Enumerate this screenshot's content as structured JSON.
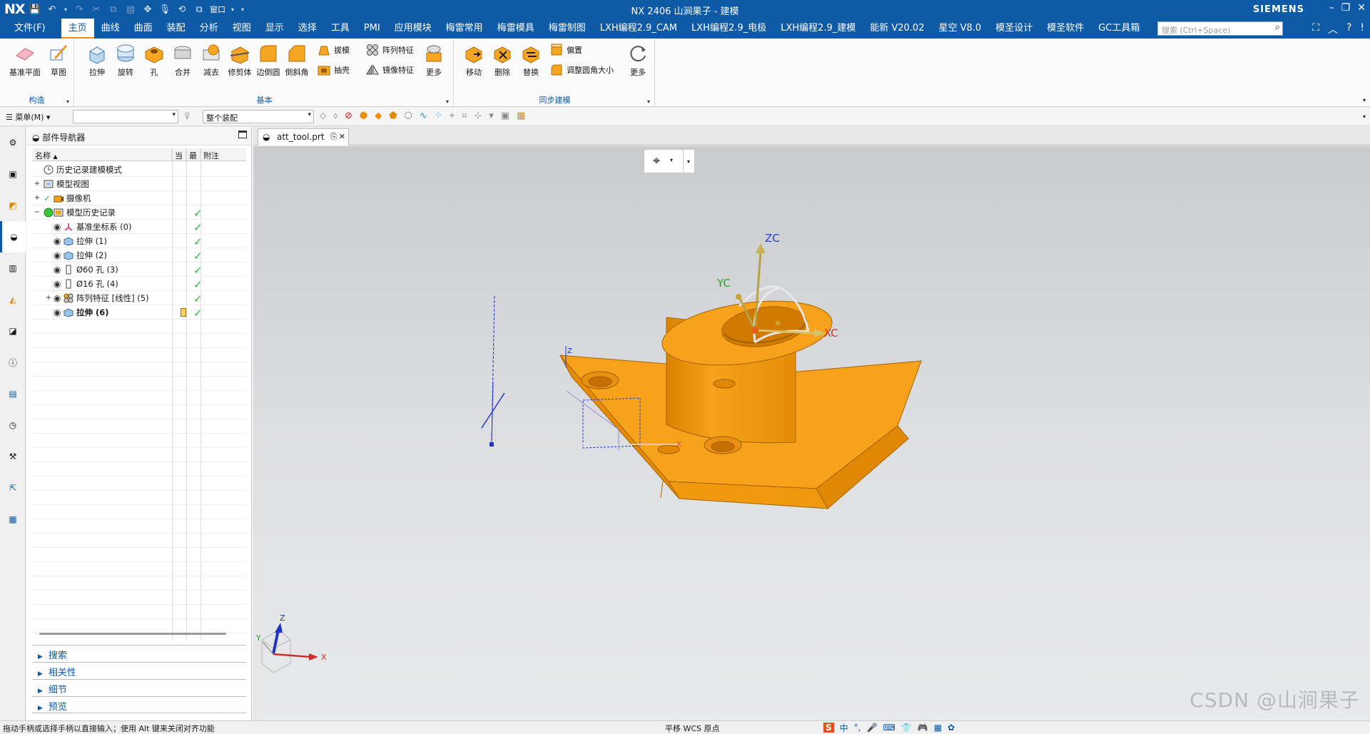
{
  "titlebar": {
    "logo": "NX",
    "title": "NX 2406 山涧果子 - 建模",
    "brand": "SIEMENS",
    "window_menu": "窗口"
  },
  "menubar": {
    "file": "文件(F)",
    "tabs": [
      "主页",
      "曲线",
      "曲面",
      "装配",
      "分析",
      "视图",
      "显示",
      "选择",
      "工具",
      "PMI",
      "应用模块",
      "梅雷常用",
      "梅雷模具",
      "梅雷制图",
      "LXH编程2.9_CAM",
      "LXH编程2.9_电极",
      "LXH编程2.9_建模",
      "能新 V20.02",
      "星空 V8.0",
      "模圣设计",
      "模圣软件",
      "GC工具箱"
    ],
    "active_tab": "主页",
    "search_placeholder": "搜索 (Ctrl+Space)"
  },
  "ribbon": {
    "construct": {
      "label": "构造",
      "datum_plane": "基准平面",
      "sketch": "草图"
    },
    "basic": {
      "label": "基本",
      "extrude": "拉伸",
      "revolve": "旋转",
      "hole": "孔",
      "unite": "合并",
      "subtract": "减去",
      "trim_body": "修剪体",
      "edge_blend": "边倒圆",
      "chamfer": "倒斜角",
      "draft": "拔模",
      "pattern_feature": "阵列特征",
      "shell": "抽壳",
      "mirror_feature": "镜像特征",
      "more": "更多"
    },
    "sync": {
      "label": "同步建模",
      "move": "移动",
      "delete": "删除",
      "replace": "替换",
      "offset": "偏置",
      "resize_blend": "调整圆角大小",
      "more": "更多"
    }
  },
  "selection_bar": {
    "menu": "菜单(M)",
    "filter_value": "",
    "scope": "整个装配"
  },
  "navigator": {
    "title": "部件导航器",
    "columns": [
      "名称",
      "当",
      "最",
      "附注"
    ],
    "rows": [
      {
        "label": "历史记录建模模式",
        "level": 0,
        "icon": "clock-icon",
        "check": false
      },
      {
        "label": "模型视图",
        "level": 0,
        "icon": "model-views-icon",
        "check": false,
        "expander": "+"
      },
      {
        "label": "摄像机",
        "level": 0,
        "icon": "camera-icon",
        "check": false,
        "expander": "+"
      },
      {
        "label": "模型历史记录",
        "level": 0,
        "icon": "history-icon",
        "check": true,
        "expander": "−"
      },
      {
        "label": "基准坐标系 (0)",
        "level": 1,
        "icon": "datum-csys-icon",
        "check": true
      },
      {
        "label": "拉伸 (1)",
        "level": 1,
        "icon": "extrude-icon",
        "check": true
      },
      {
        "label": "拉伸 (2)",
        "level": 1,
        "icon": "extrude-icon",
        "check": true
      },
      {
        "label": "Ø60 孔 (3)",
        "level": 1,
        "icon": "hole-icon",
        "check": true
      },
      {
        "label": "Ø16 孔 (4)",
        "level": 1,
        "icon": "hole-icon",
        "check": true
      },
      {
        "label": "阵列特征 [线性] (5)",
        "level": 1,
        "icon": "pattern-icon",
        "check": true,
        "expander": "+"
      },
      {
        "label": "拉伸 (6)",
        "level": 1,
        "icon": "extrude-icon",
        "check": true,
        "bold": true,
        "current": true
      }
    ],
    "panels": [
      "搜索",
      "相关性",
      "细节",
      "预览"
    ]
  },
  "viewport": {
    "tab_label": "att_tool.prt",
    "wcs_labels": {
      "zc": "ZC",
      "yc": "YC",
      "xc": "XC"
    },
    "triad_labels": {
      "z": "Z",
      "y": "Y",
      "x": "X"
    },
    "watermark": "CSDN @山涧果子"
  },
  "status": {
    "message": "拖动手柄或选择手柄以直接输入；使用 Alt 键来关闭对齐功能",
    "center": "平移 WCS 原点",
    "ime_items": [
      "S",
      "中",
      "°,",
      "🎤",
      "⌨",
      "👕",
      "🎮",
      "▦",
      "✿"
    ]
  },
  "colors": {
    "brand_blue": "#0e5aa6",
    "model_orange": "#f7a21b",
    "check_green": "#2fb83a"
  }
}
